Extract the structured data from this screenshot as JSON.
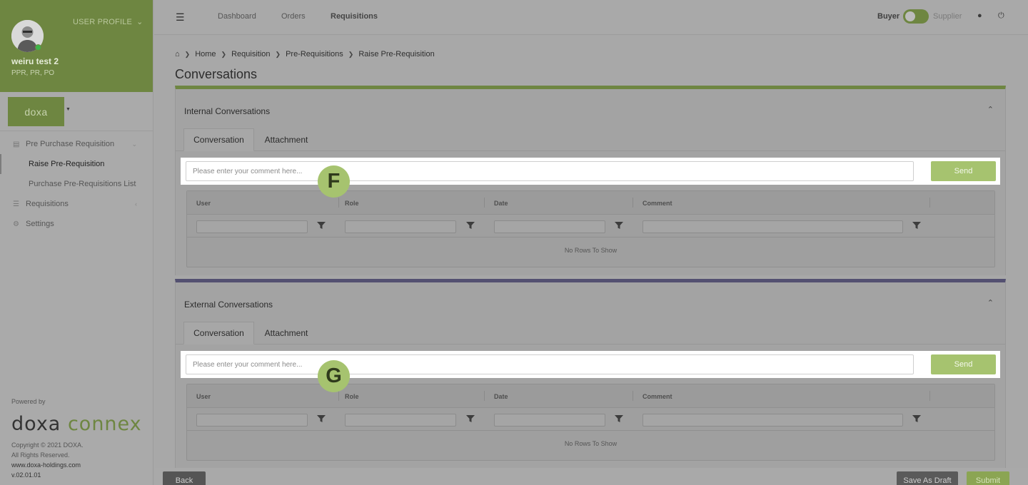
{
  "sidebar": {
    "user_profile_label": "USER PROFILE",
    "user_name": "weiru test 2",
    "user_roles": "PPR, PR, PO",
    "company_logo_text": "doxa",
    "nav": {
      "pre_purchase": "Pre Purchase Requisition",
      "raise_pre_requisition": "Raise Pre-Requisition",
      "purchase_list": "Purchase Pre-Requisitions List",
      "requisitions": "Requisitions",
      "settings": "Settings"
    },
    "powered_by": "Powered by",
    "brand_part1": "doxa",
    "brand_part2": "connex",
    "copyright": "Copyright © 2021 DOXA.",
    "rights": "All Rights Reserved.",
    "website": "www.doxa-holdings.com",
    "version": "v.02.01.01"
  },
  "topbar": {
    "links": {
      "dashboard": "Dashboard",
      "orders": "Orders",
      "requisitions": "Requisitions"
    },
    "role_buyer": "Buyer",
    "role_supplier": "Supplier"
  },
  "breadcrumb": {
    "home": "Home",
    "requisition": "Requisition",
    "pre_requisitions": "Pre-Requisitions",
    "current": "Raise Pre-Requisition"
  },
  "page_title": "Conversations",
  "internal": {
    "title": "Internal Conversations",
    "tab_conversation": "Conversation",
    "tab_attachment": "Attachment",
    "comment_placeholder": "Please enter your comment here...",
    "send_label": "Send",
    "columns": {
      "user": "User",
      "role": "Role",
      "date": "Date",
      "comment": "Comment"
    },
    "empty_text": "No Rows To Show",
    "badge": "F"
  },
  "external": {
    "title": "External Conversations",
    "tab_conversation": "Conversation",
    "tab_attachment": "Attachment",
    "comment_placeholder": "Please enter your comment here...",
    "send_label": "Send",
    "columns": {
      "user": "User",
      "role": "Role",
      "date": "Date",
      "comment": "Comment"
    },
    "empty_text": "No Rows To Show",
    "badge": "G"
  },
  "actions": {
    "back": "Back",
    "save_draft": "Save As Draft",
    "submit": "Submit"
  },
  "colors": {
    "brand_green": "#6e8641",
    "accent_green": "#a6c36f",
    "external_border": "#535071"
  }
}
